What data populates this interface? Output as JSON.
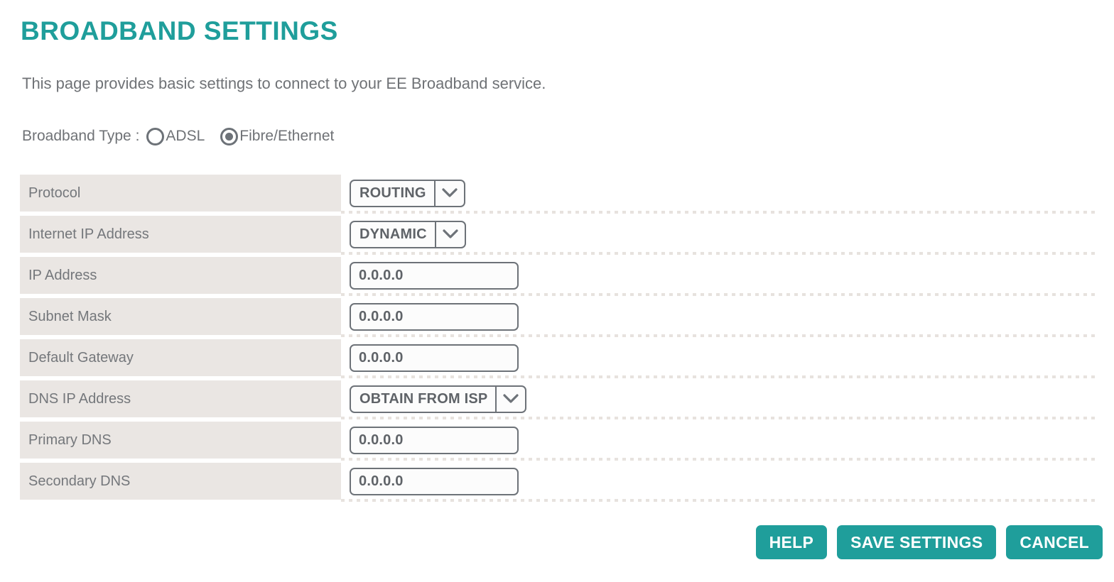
{
  "header": {
    "title": "BROADBAND SETTINGS",
    "description": "This page provides basic settings to connect to your EE Broadband service."
  },
  "broadband_type": {
    "label": "Broadband Type :",
    "options": [
      {
        "label": "ADSL",
        "selected": false
      },
      {
        "label": "Fibre/Ethernet",
        "selected": true
      }
    ]
  },
  "settings": {
    "rows": [
      {
        "label": "Protocol",
        "control": "select",
        "value": "ROUTING"
      },
      {
        "label": "Internet IP Address",
        "control": "select",
        "value": "DYNAMIC"
      },
      {
        "label": "IP Address",
        "control": "text",
        "value": "0.0.0.0"
      },
      {
        "label": "Subnet Mask",
        "control": "text",
        "value": "0.0.0.0"
      },
      {
        "label": "Default Gateway",
        "control": "text",
        "value": "0.0.0.0"
      },
      {
        "label": "DNS IP Address",
        "control": "select",
        "value": "OBTAIN FROM ISP"
      },
      {
        "label": "Primary DNS",
        "control": "text",
        "value": "0.0.0.0"
      },
      {
        "label": "Secondary DNS",
        "control": "text",
        "value": "0.0.0.0"
      }
    ]
  },
  "buttons": [
    {
      "label": "HELP"
    },
    {
      "label": "SAVE SETTINGS"
    },
    {
      "label": "CANCEL"
    }
  ],
  "colors": {
    "accent_teal": "#1f9e9b",
    "row_background": "#eae6e3",
    "label_text": "#74777b",
    "control_border": "#6d7278"
  }
}
